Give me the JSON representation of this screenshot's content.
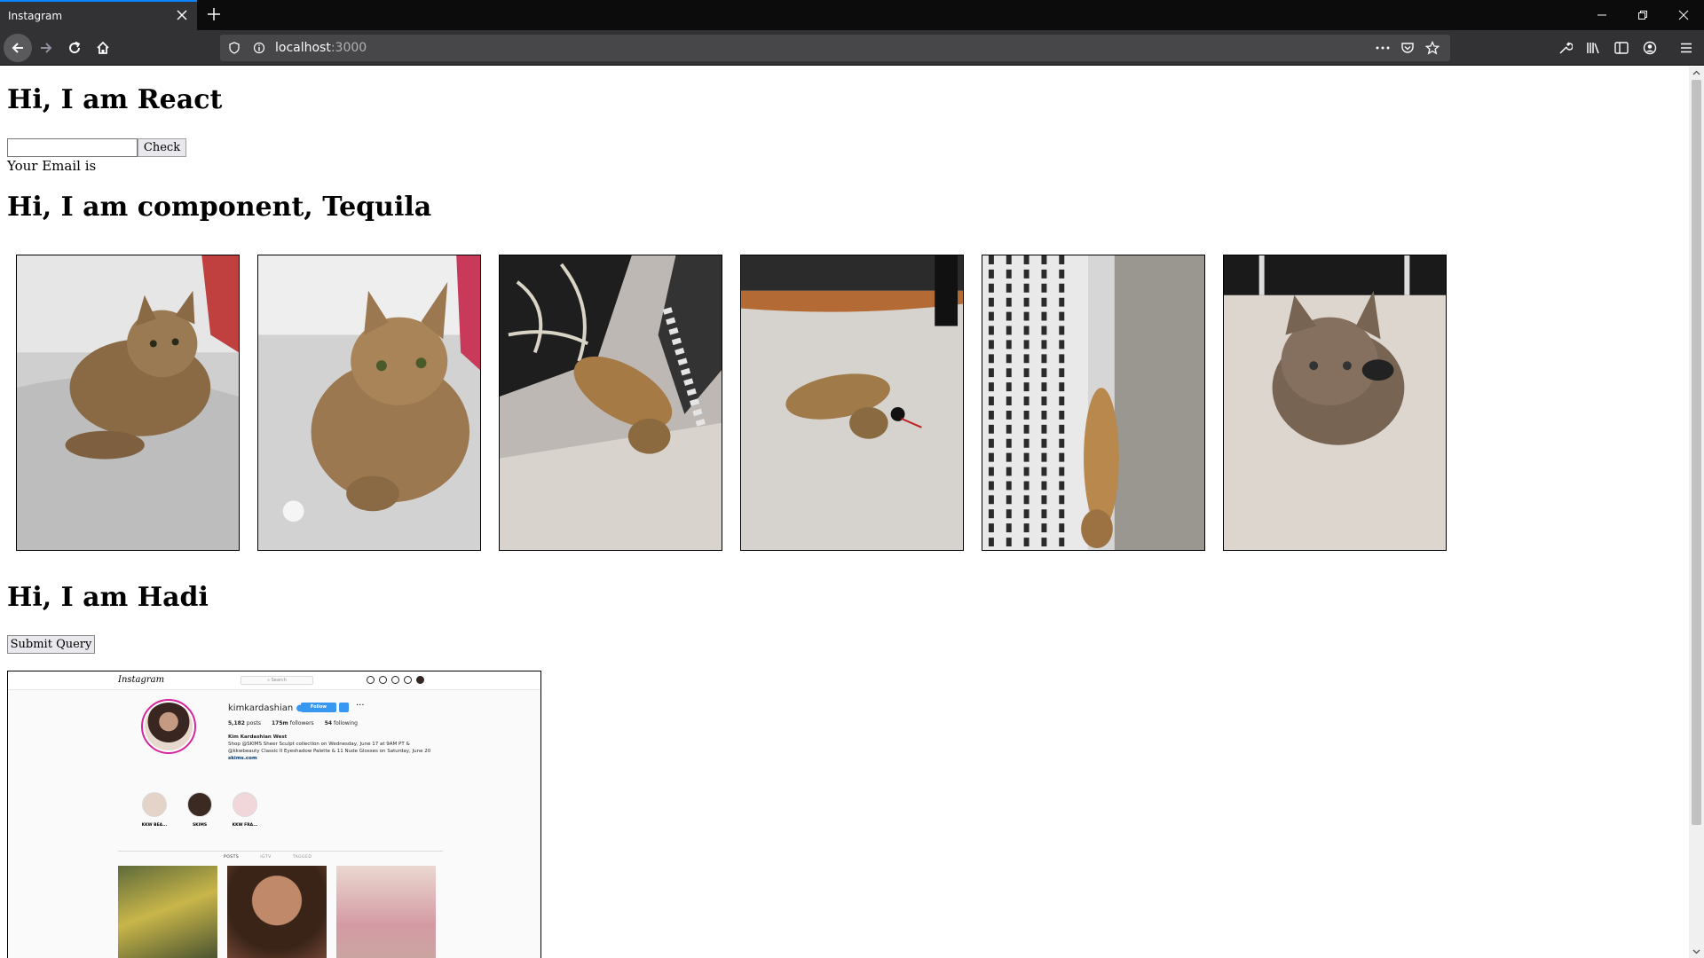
{
  "browser": {
    "tab_title": "Instagram",
    "url_host": "localhost",
    "url_port": ":3000",
    "accent": "#0a84ff"
  },
  "page": {
    "heading_react": "Hi, I am React",
    "email_input_value": "",
    "check_label": "Check",
    "email_text": "Your Email is",
    "heading_component": "Hi, I am component, Tequila",
    "cat_images": [
      {
        "name": "cat-photo-1"
      },
      {
        "name": "cat-photo-2"
      },
      {
        "name": "cat-photo-3"
      },
      {
        "name": "cat-photo-4"
      },
      {
        "name": "cat-photo-5"
      },
      {
        "name": "cat-photo-6"
      }
    ],
    "heading_hadi": "Hi, I am Hadi",
    "submit_label": "Submit Query"
  },
  "instagram_screenshot": {
    "logo": "Instagram",
    "search": "Search",
    "username": "kimkardashian",
    "follow_label": "Follow",
    "more": "···",
    "posts": "5,182",
    "posts_label": "posts",
    "followers": "175m",
    "followers_label": "followers",
    "following": "54",
    "following_label": "following",
    "bio_name": "Kim Kardashian West",
    "bio_line1": "Shop @SKIMS Sheer Sculpt collection on Wednesday, June 17 at 9AM PT &",
    "bio_line2": "@kkwbeauty Classic II Eyeshadow Palette & 11 Nude Glosses on Saturday, June 20",
    "bio_link": "skims.com",
    "highlights": [
      "KKW BEA...",
      "SKIMS",
      "KKW FRA..."
    ],
    "tabs": [
      "POSTS",
      "IGTV",
      "TAGGED"
    ]
  }
}
